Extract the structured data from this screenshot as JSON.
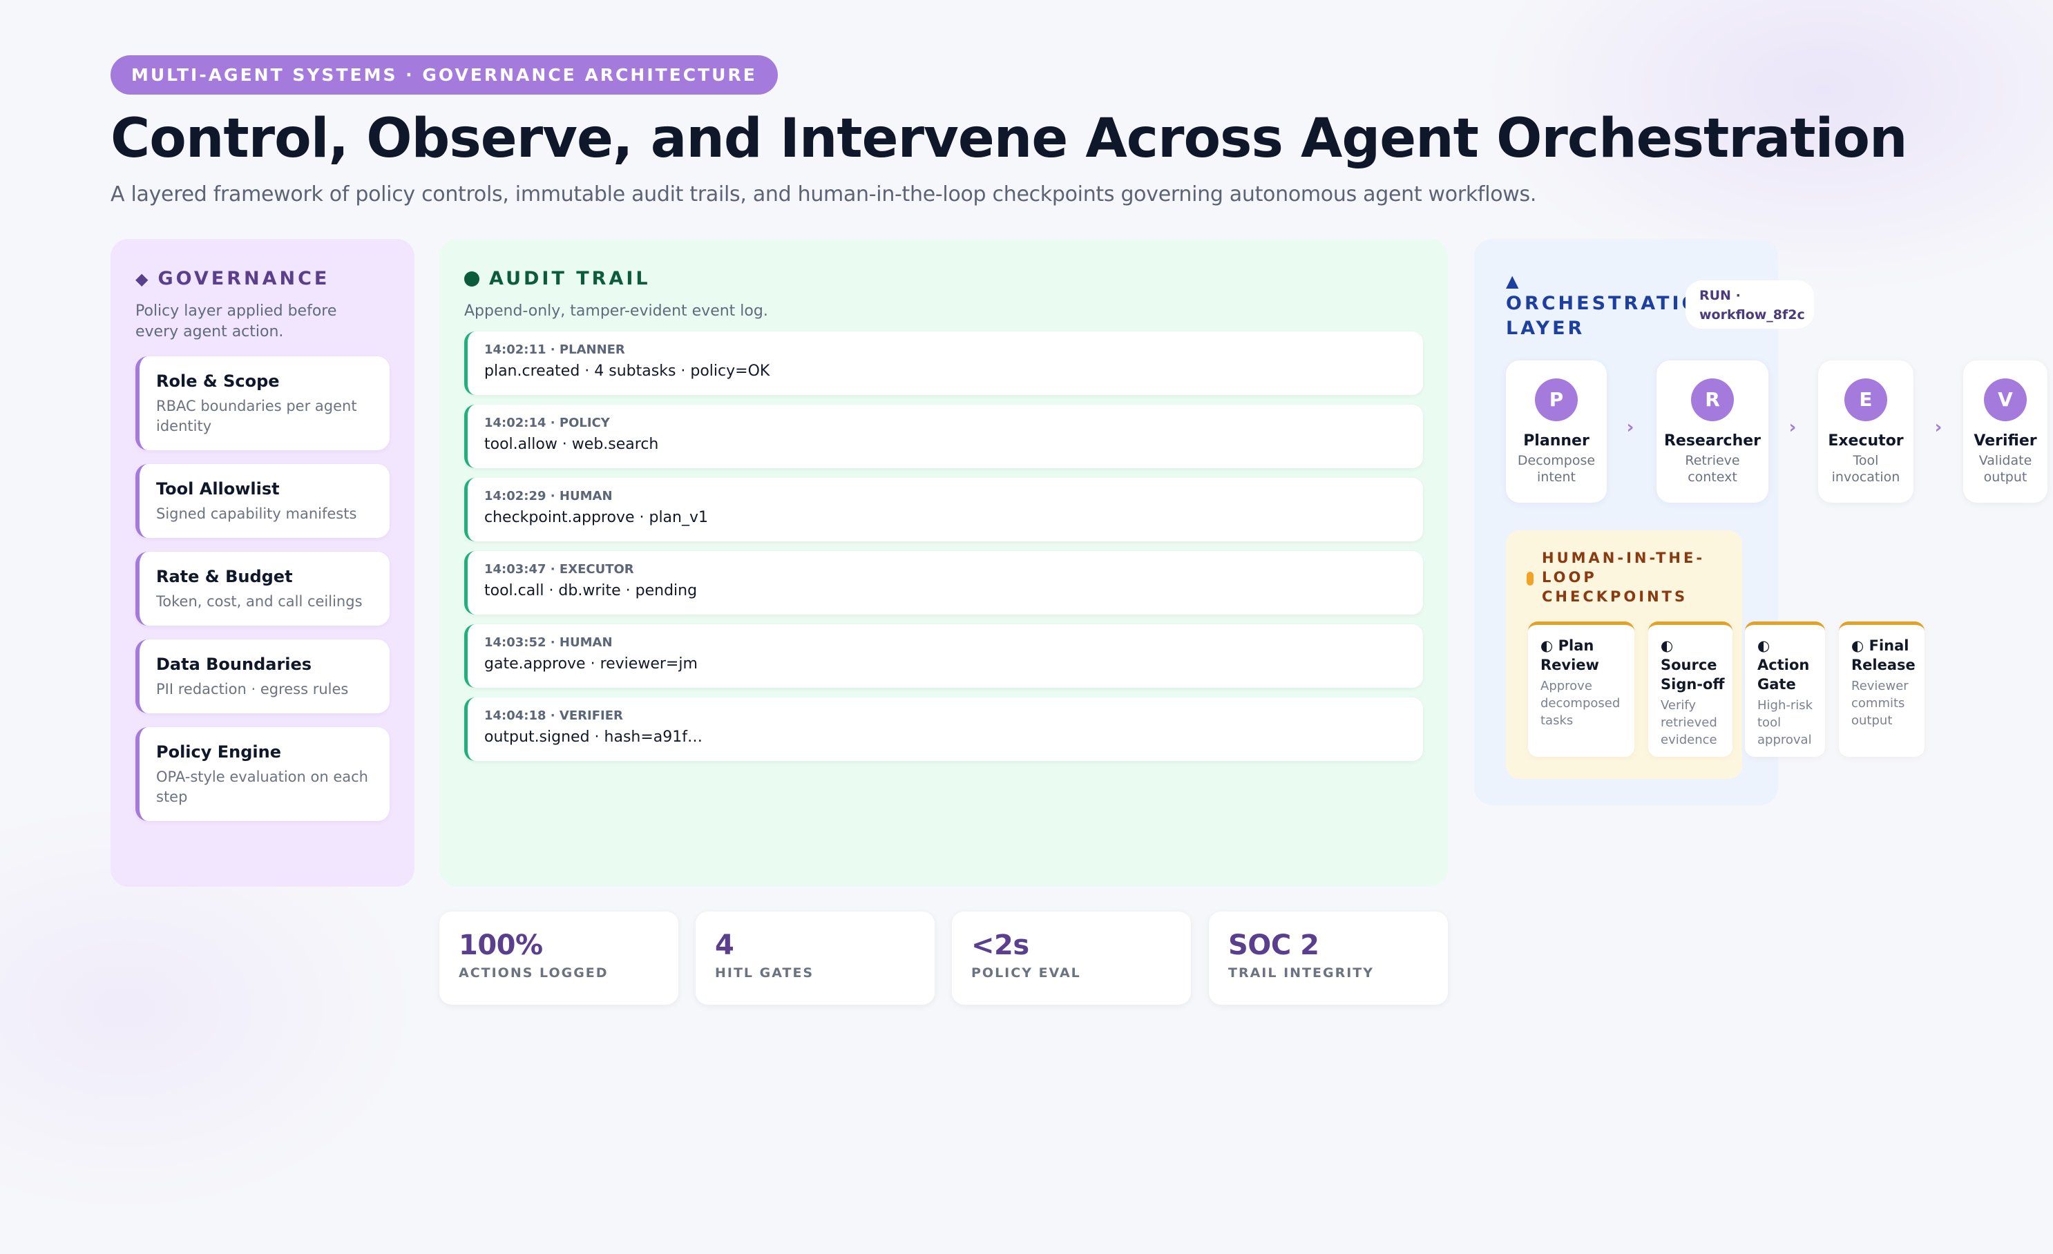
{
  "header": {
    "eyebrow": "MULTI-AGENT SYSTEMS · GOVERNANCE ARCHITECTURE",
    "title": "Control, Observe, and Intervene Across Agent Orchestration",
    "subtitle": "A layered framework of policy controls, immutable audit trails, and human-in-the-loop checkpoints governing autonomous agent workflows."
  },
  "governance": {
    "icon": "diamond-icon",
    "title": "GOVERNANCE",
    "description": "Policy layer applied before every agent action.",
    "cards": [
      {
        "title": "Role & Scope",
        "description": "RBAC boundaries per agent identity"
      },
      {
        "title": "Tool Allowlist",
        "description": "Signed capability manifests"
      },
      {
        "title": "Rate & Budget",
        "description": "Token, cost, and call ceilings"
      },
      {
        "title": "Data Boundaries",
        "description": "PII redaction · egress rules"
      },
      {
        "title": "Policy Engine",
        "description": "OPA-style evaluation on each step"
      }
    ]
  },
  "audit": {
    "icon": "dot-icon",
    "title": "AUDIT TRAIL",
    "description": "Append-only, tamper-evident event log.",
    "entries": [
      {
        "meta": "14:02:11 · PLANNER",
        "event": "plan.created · 4 subtasks · policy=OK"
      },
      {
        "meta": "14:02:14 · POLICY",
        "event": "tool.allow · web.search"
      },
      {
        "meta": "14:02:29 · HUMAN",
        "event": "checkpoint.approve · plan_v1"
      },
      {
        "meta": "14:03:47 · EXECUTOR",
        "event": "tool.call · db.write · pending"
      },
      {
        "meta": "14:03:52 · HUMAN",
        "event": "gate.approve · reviewer=jm"
      },
      {
        "meta": "14:04:18 · VERIFIER",
        "event": "output.signed · hash=a91f…"
      }
    ]
  },
  "metrics": [
    {
      "value": "100%",
      "label": "ACTIONS LOGGED"
    },
    {
      "value": "4",
      "label": "HITL GATES"
    },
    {
      "value": "<2s",
      "label": "POLICY EVAL"
    },
    {
      "value": "SOC 2",
      "label": "TRAIL INTEGRITY"
    }
  ],
  "orchestration": {
    "icon": "triangle-icon",
    "title_line1": "ORCHESTRATION",
    "title_line2": "LAYER",
    "run_label": "RUN ·",
    "run_id": "workflow_8f2c",
    "agents": [
      {
        "initial": "P",
        "name": "Planner",
        "role_line1": "Decompose",
        "role_line2": "intent"
      },
      {
        "initial": "R",
        "name": "Researcher",
        "role_line1": "Retrieve",
        "role_line2": "context"
      },
      {
        "initial": "E",
        "name": "Executor",
        "role_line1": "Tool",
        "role_line2": "invocation"
      },
      {
        "initial": "V",
        "name": "Verifier",
        "role_line1": "Validate",
        "role_line2": "output"
      }
    ],
    "arrow_glyph": "›",
    "hitl": {
      "title": "HUMAN-IN-THE-LOOP CHECKPOINTS",
      "icon_glyph": "◐",
      "checkpoints": [
        {
          "title": "Plan Review",
          "description": "Approve decomposed tasks"
        },
        {
          "title": "Source Sign-off",
          "description": "Verify retrieved evidence"
        },
        {
          "title": "Action Gate",
          "description": "High-risk tool approval"
        },
        {
          "title": "Final Release",
          "description": "Reviewer commits output"
        }
      ]
    }
  },
  "colors": {
    "accent": "#a47bdd",
    "governance_bg": "#f2e5fe",
    "audit_bg": "#eafbf1",
    "audit_accent": "#1fb07c",
    "orchestration_bg": "#edf3fd",
    "orchestration_heading": "#1c3fa0",
    "hitl_bg": "#fdf6df",
    "hitl_accent": "#e0a227"
  }
}
